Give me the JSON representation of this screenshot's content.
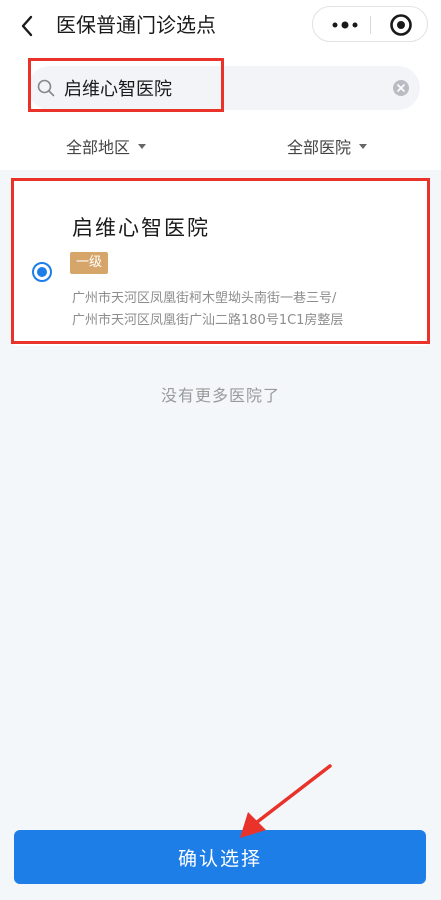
{
  "header": {
    "title": "医保普通门诊选点",
    "back_icon": "chevron-left-icon",
    "more_icon": "more-dots-icon",
    "close_icon": "target-circle-icon"
  },
  "search": {
    "value": "启维心智医院",
    "placeholder": "",
    "icon": "search-icon",
    "clear_icon": "clear-circle-icon"
  },
  "filters": {
    "region_label": "全部地区",
    "hospital_label": "全部医院"
  },
  "result": {
    "name": "启维心智医院",
    "level": "一级",
    "address_line1": "广州市天河区凤凰街柯木塱坳头南街一巷三号/",
    "address_line2": "广州市天河区凤凰街广汕二路180号1C1房整层",
    "selected": true
  },
  "list_end_text": "没有更多医院了",
  "confirm_label": "确认选择",
  "colors": {
    "accent": "#1e7ee8",
    "badge": "#d6a56a",
    "highlight": "#e8322a",
    "background": "#f4f7fa"
  }
}
